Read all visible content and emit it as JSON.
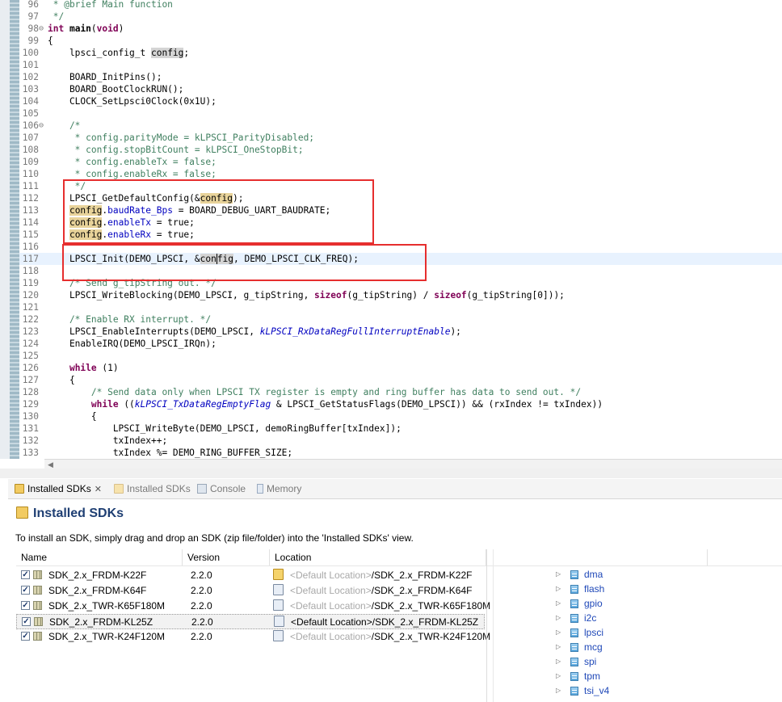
{
  "editor": {
    "lines": [
      {
        "n": "96",
        "segs": [
          {
            "t": " * @brief Main function",
            "c": "cm"
          }
        ]
      },
      {
        "n": "97",
        "segs": [
          {
            "t": " */",
            "c": "cm"
          }
        ]
      },
      {
        "n": "98",
        "fold": "⊖",
        "segs": [
          {
            "t": "int",
            "c": "kw"
          },
          {
            "t": " "
          },
          {
            "t": "main",
            "c": "b"
          },
          {
            "t": "("
          },
          {
            "t": "void",
            "c": "kw"
          },
          {
            "t": ")"
          }
        ]
      },
      {
        "n": "99",
        "segs": [
          {
            "t": "{"
          }
        ]
      },
      {
        "n": "100",
        "segs": [
          {
            "t": "    lpsci_config_t "
          },
          {
            "t": "config",
            "c": "occ2"
          },
          {
            "t": ";"
          }
        ]
      },
      {
        "n": "101",
        "segs": []
      },
      {
        "n": "102",
        "segs": [
          {
            "t": "    BOARD_InitPins();"
          }
        ]
      },
      {
        "n": "103",
        "segs": [
          {
            "t": "    BOARD_BootClockRUN();"
          }
        ]
      },
      {
        "n": "104",
        "segs": [
          {
            "t": "    CLOCK_SetLpsci0Clock(0x1U);"
          }
        ]
      },
      {
        "n": "105",
        "segs": []
      },
      {
        "n": "106",
        "fold": "⊖",
        "segs": [
          {
            "t": "    /*",
            "c": "cm"
          }
        ]
      },
      {
        "n": "107",
        "segs": [
          {
            "t": "     * config.parityMode = kLPSCI_ParityDisabled;",
            "c": "cm"
          }
        ]
      },
      {
        "n": "108",
        "segs": [
          {
            "t": "     * config.stopBitCount = kLPSCI_OneStopBit;",
            "c": "cm"
          }
        ]
      },
      {
        "n": "109",
        "segs": [
          {
            "t": "     * config.enableTx = false;",
            "c": "cm"
          }
        ]
      },
      {
        "n": "110",
        "segs": [
          {
            "t": "     * config.enableRx = false;",
            "c": "cm"
          }
        ]
      },
      {
        "n": "111",
        "segs": [
          {
            "t": "     */",
            "c": "cm"
          }
        ]
      },
      {
        "n": "112",
        "segs": [
          {
            "t": "    LPSCI_GetDefaultConfig(&"
          },
          {
            "t": "config",
            "c": "occ"
          },
          {
            "t": ");"
          }
        ]
      },
      {
        "n": "113",
        "segs": [
          {
            "t": "    "
          },
          {
            "t": "config",
            "c": "occ"
          },
          {
            "t": "."
          },
          {
            "t": "baudRate_Bps",
            "c": "fld"
          },
          {
            "t": " = BOARD_DEBUG_UART_BAUDRATE;"
          }
        ]
      },
      {
        "n": "114",
        "segs": [
          {
            "t": "    "
          },
          {
            "t": "config",
            "c": "occ"
          },
          {
            "t": "."
          },
          {
            "t": "enableTx",
            "c": "fld"
          },
          {
            "t": " = true;"
          }
        ]
      },
      {
        "n": "115",
        "segs": [
          {
            "t": "    "
          },
          {
            "t": "config",
            "c": "occ"
          },
          {
            "t": "."
          },
          {
            "t": "enableRx",
            "c": "fld"
          },
          {
            "t": " = true;"
          }
        ]
      },
      {
        "n": "116",
        "segs": []
      },
      {
        "n": "117",
        "current": true,
        "segs": [
          {
            "t": "    LPSCI_Init(DEMO_LPSCI, &"
          },
          {
            "t": "con",
            "c": "occ2"
          },
          {
            "t": "fig",
            "c": "occ2 caret"
          },
          {
            "t": ", DEMO_LPSCI_CLK_FREQ);"
          }
        ]
      },
      {
        "n": "118",
        "segs": []
      },
      {
        "n": "119",
        "segs": [
          {
            "t": "    /* Send g_tipString out. */",
            "c": "cm"
          }
        ]
      },
      {
        "n": "120",
        "segs": [
          {
            "t": "    LPSCI_WriteBlocking(DEMO_LPSCI, g_tipString, "
          },
          {
            "t": "sizeof",
            "c": "kw"
          },
          {
            "t": "(g_tipString) / "
          },
          {
            "t": "sizeof",
            "c": "kw"
          },
          {
            "t": "(g_tipString[0]));"
          }
        ]
      },
      {
        "n": "121",
        "segs": []
      },
      {
        "n": "122",
        "segs": [
          {
            "t": "    /* Enable RX interrupt. */",
            "c": "cm"
          }
        ]
      },
      {
        "n": "123",
        "segs": [
          {
            "t": "    LPSCI_EnableInterrupts(DEMO_LPSCI, "
          },
          {
            "t": "kLPSCI_RxDataRegFullInterruptEnable",
            "c": "en"
          },
          {
            "t": ");"
          }
        ]
      },
      {
        "n": "124",
        "segs": [
          {
            "t": "    EnableIRQ(DEMO_LPSCI_IRQn);"
          }
        ]
      },
      {
        "n": "125",
        "segs": []
      },
      {
        "n": "126",
        "segs": [
          {
            "t": "    "
          },
          {
            "t": "while",
            "c": "kw"
          },
          {
            "t": " (1)"
          }
        ]
      },
      {
        "n": "127",
        "segs": [
          {
            "t": "    {"
          }
        ]
      },
      {
        "n": "128",
        "segs": [
          {
            "t": "        /* Send data only when LPSCI TX register is empty and ring buffer has data to send out. */",
            "c": "cm"
          }
        ]
      },
      {
        "n": "129",
        "segs": [
          {
            "t": "        "
          },
          {
            "t": "while",
            "c": "kw"
          },
          {
            "t": " (("
          },
          {
            "t": "kLPSCI_TxDataRegEmptyFlag",
            "c": "en"
          },
          {
            "t": " & LPSCI_GetStatusFlags(DEMO_LPSCI)) && (rxIndex != txIndex))"
          }
        ]
      },
      {
        "n": "130",
        "segs": [
          {
            "t": "        {"
          }
        ]
      },
      {
        "n": "131",
        "segs": [
          {
            "t": "            LPSCI_WriteByte(DEMO_LPSCI, demoRingBuffer[txIndex]);"
          }
        ]
      },
      {
        "n": "132",
        "segs": [
          {
            "t": "            txIndex++;"
          }
        ]
      },
      {
        "n": "133",
        "segs": [
          {
            "t": "            txIndex %= DEMO_RING_BUFFER_SIZE;"
          }
        ]
      }
    ]
  },
  "tabs": [
    {
      "label": "Installed SDKs",
      "icon": "sdk-icon",
      "active": true,
      "closable": true
    },
    {
      "label": "Installed SDKs",
      "icon": "sdk-icon",
      "active": false
    },
    {
      "label": "Console",
      "icon": "console-icon",
      "active": false
    },
    {
      "label": "Memory",
      "icon": "memory-icon",
      "active": false
    }
  ],
  "panel": {
    "title": "Installed SDKs",
    "description": "To install an SDK, simply drag and drop an SDK (zip file/folder) into the 'Installed SDKs' view.",
    "columns": {
      "name": "Name",
      "version": "Version",
      "location": "Location"
    },
    "rows": [
      {
        "name": "SDK_2.x_FRDM-K22F",
        "version": "2.2.0",
        "loc_prefix": "<Default Location>",
        "loc_suffix": "/SDK_2.x_FRDM-K22F",
        "checked": true,
        "loc_icon": "folder-icon",
        "selected": false
      },
      {
        "name": "SDK_2.x_FRDM-K64F",
        "version": "2.2.0",
        "loc_prefix": "<Default Location>",
        "loc_suffix": "/SDK_2.x_FRDM-K64F",
        "checked": true,
        "loc_icon": "archive-icon",
        "selected": false
      },
      {
        "name": "SDK_2.x_TWR-K65F180M",
        "version": "2.2.0",
        "loc_prefix": "<Default Location>",
        "loc_suffix": "/SDK_2.x_TWR-K65F180M",
        "checked": true,
        "loc_icon": "archive-icon",
        "selected": false
      },
      {
        "name": "SDK_2.x_FRDM-KL25Z",
        "version": "2.2.0",
        "loc_prefix": "<Default Location>",
        "loc_suffix": "/SDK_2.x_FRDM-KL25Z",
        "checked": true,
        "loc_icon": "archive-icon",
        "selected": true
      },
      {
        "name": "SDK_2.x_TWR-K24F120M",
        "version": "2.2.0",
        "loc_prefix": "<Default Location>",
        "loc_suffix": "/SDK_2.x_TWR-K24F120M",
        "checked": true,
        "loc_icon": "archive-icon",
        "selected": false
      }
    ],
    "tree": [
      "dma",
      "flash",
      "gpio",
      "i2c",
      "lpsci",
      "mcg",
      "spi",
      "tpm",
      "tsi_v4"
    ]
  },
  "colors": {
    "keyword": "#7f0055",
    "comment": "#3f7f5f",
    "field": "#0000c0",
    "highlight_box": "#e62e2e",
    "title": "#1f3f73"
  }
}
